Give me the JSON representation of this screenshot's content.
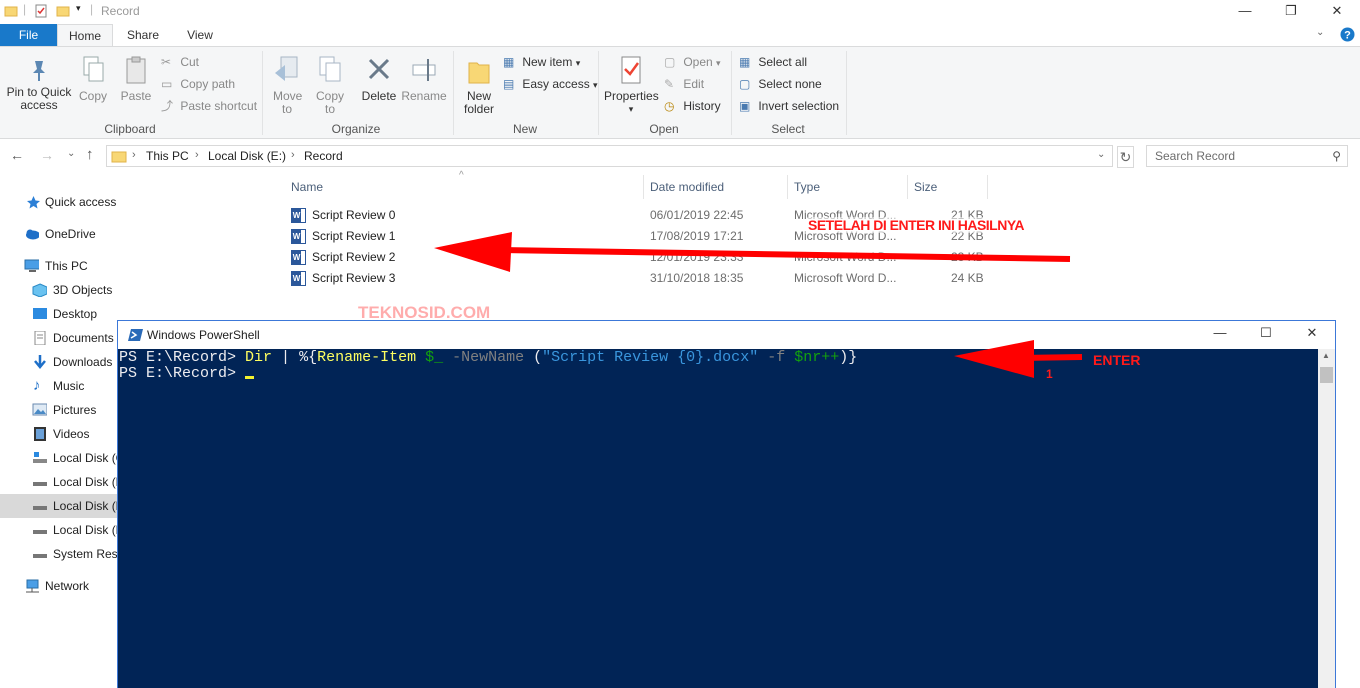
{
  "window": {
    "title": "Record"
  },
  "tabs": {
    "file": "File",
    "home": "Home",
    "share": "Share",
    "view": "View"
  },
  "ribbon": {
    "clipboard": {
      "label": "Clipboard",
      "pin": "Pin to Quick access",
      "copy": "Copy",
      "paste": "Paste",
      "cut": "Cut",
      "copy_path": "Copy path",
      "paste_shortcut": "Paste shortcut"
    },
    "organize": {
      "label": "Organize",
      "move_to": "Move to",
      "copy_to": "Copy to",
      "delete": "Delete",
      "rename": "Rename"
    },
    "new": {
      "label": "New",
      "new_folder": "New folder",
      "new_item": "New item",
      "easy_access": "Easy access"
    },
    "open": {
      "label": "Open",
      "properties": "Properties",
      "open": "Open",
      "edit": "Edit",
      "history": "History"
    },
    "select": {
      "label": "Select",
      "select_all": "Select all",
      "select_none": "Select none",
      "invert": "Invert selection"
    }
  },
  "address": {
    "crumbs": [
      "This PC",
      "Local Disk (E:)",
      "Record"
    ],
    "search_placeholder": "Search Record"
  },
  "nav": {
    "quick_access": "Quick access",
    "onedrive": "OneDrive",
    "this_pc": "This PC",
    "items": [
      "3D Objects",
      "Desktop",
      "Documents",
      "Downloads",
      "Music",
      "Pictures",
      "Videos",
      "Local Disk (C:)",
      "Local Disk (D:)",
      "Local Disk (E:)",
      "Local Disk (F:)",
      "System Reserved"
    ],
    "network": "Network"
  },
  "columns": {
    "name": "Name",
    "date": "Date modified",
    "type": "Type",
    "size": "Size"
  },
  "files": [
    {
      "name": "Script Review 0",
      "date": "06/01/2019 22:45",
      "type": "Microsoft Word D...",
      "size": "21 KB"
    },
    {
      "name": "Script Review 1",
      "date": "17/08/2019 17:21",
      "type": "Microsoft Word D...",
      "size": "22 KB"
    },
    {
      "name": "Script Review 2",
      "date": "12/01/2019 23:33",
      "type": "Microsoft Word D...",
      "size": "23 KB"
    },
    {
      "name": "Script Review 3",
      "date": "31/10/2018 18:35",
      "type": "Microsoft Word D...",
      "size": "24 KB"
    }
  ],
  "annotations": {
    "result": "SETELAH DI ENTER INI HASILNYA",
    "watermark": "TEKNOSID.COM",
    "enter": "ENTER",
    "step": "1"
  },
  "powershell": {
    "title": "Windows PowerShell",
    "line1": {
      "prompt": "PS E:\\Record> ",
      "cmd1": "Dir",
      "pipe": " | ",
      "p1": "%{",
      "cmd2": "Rename-Item",
      "var1": " $_",
      "param": " -NewName ",
      "p2": "(",
      "str": "\"Script Review {0}.docx\"",
      "op": " -f ",
      "var2": "$nr++",
      "p3": ")}"
    },
    "line2": {
      "prompt": "PS E:\\Record> "
    }
  },
  "colors": {
    "accent": "#1979ca",
    "ps_bg": "#012456",
    "annotation": "#ff1a1a"
  }
}
